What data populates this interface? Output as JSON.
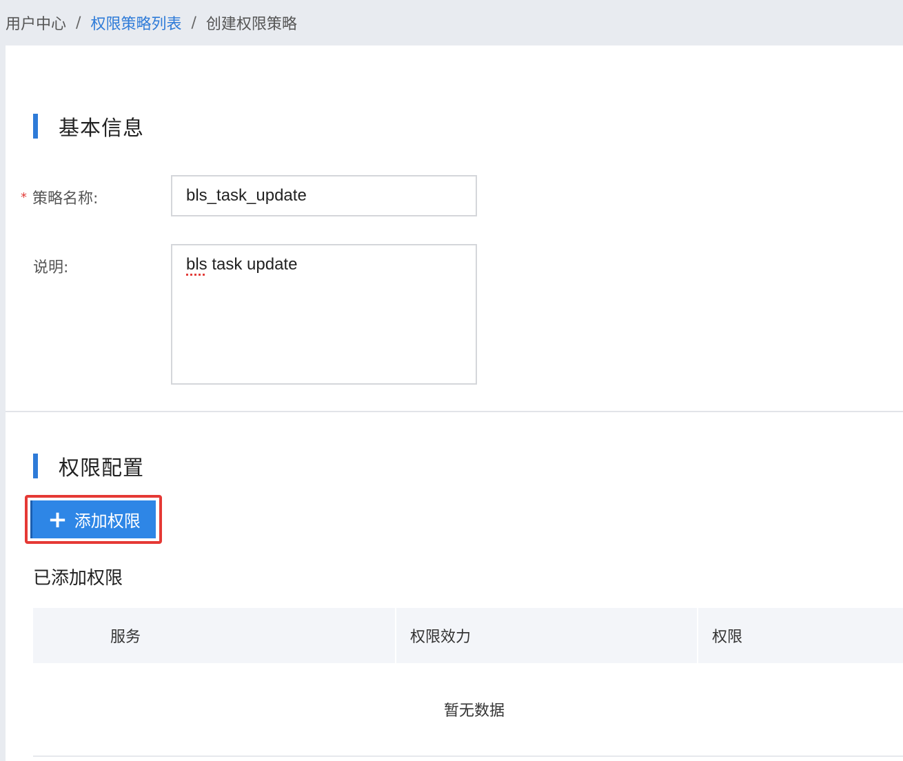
{
  "breadcrumb": {
    "root": "用户中心",
    "separator": "/",
    "list": "权限策略列表",
    "current": "创建权限策略"
  },
  "basic_info": {
    "title": "基本信息",
    "required_mark": "*",
    "name_label": "策略名称:",
    "name_value": "bls_task_update",
    "desc_label": "说明:",
    "desc_value_word1": "bls",
    "desc_value_rest": " task update"
  },
  "permission_config": {
    "title": "权限配置",
    "add_button_icon": "+",
    "add_button_label": "添加权限",
    "added_title": "已添加权限",
    "table": {
      "columns": [
        "服务",
        "权限效力",
        "权限"
      ],
      "empty_text": "暂无数据"
    }
  },
  "colors": {
    "accent": "#2e7bd8",
    "button": "#2e86e6",
    "highlight": "#e53935"
  }
}
